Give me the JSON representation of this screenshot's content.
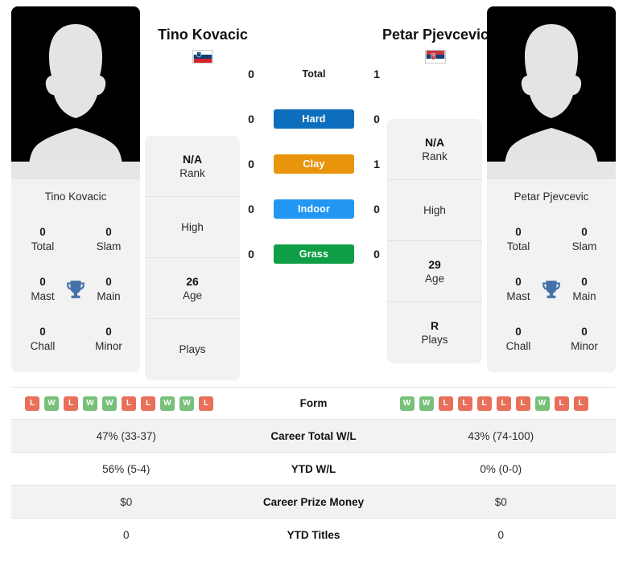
{
  "players": {
    "left": {
      "name": "Tino Kovacic",
      "card_name": "Tino Kovacic",
      "flag": "slovenia-flag",
      "rank": "N/A",
      "rank_label": "Rank",
      "high": "",
      "high_label": "High",
      "age": "26",
      "age_label": "Age",
      "plays": "",
      "plays_label": "Plays",
      "titles": {
        "total": "0",
        "total_label": "Total",
        "slam": "0",
        "slam_label": "Slam",
        "mast": "0",
        "mast_label": "Mast",
        "main": "0",
        "main_label": "Main",
        "chall": "0",
        "chall_label": "Chall",
        "minor": "0",
        "minor_label": "Minor"
      },
      "form": [
        "L",
        "W",
        "L",
        "W",
        "W",
        "L",
        "L",
        "W",
        "W",
        "L"
      ],
      "career_wl": "47% (33-37)",
      "ytd_wl": "56% (5-4)",
      "career_prize": "$0",
      "ytd_titles": "0"
    },
    "right": {
      "name": "Petar Pjevcevic",
      "card_name": "Petar Pjevcevic",
      "flag": "serbia-flag",
      "rank": "N/A",
      "rank_label": "Rank",
      "high": "",
      "high_label": "High",
      "age": "29",
      "age_label": "Age",
      "plays": "R",
      "plays_label": "Plays",
      "titles": {
        "total": "0",
        "total_label": "Total",
        "slam": "0",
        "slam_label": "Slam",
        "mast": "0",
        "mast_label": "Mast",
        "main": "0",
        "main_label": "Main",
        "chall": "0",
        "chall_label": "Chall",
        "minor": "0",
        "minor_label": "Minor"
      },
      "form": [
        "W",
        "W",
        "L",
        "L",
        "L",
        "L",
        "L",
        "W",
        "L",
        "L"
      ],
      "career_wl": "43% (74-100)",
      "ytd_wl": "0% (0-0)",
      "career_prize": "$0",
      "ytd_titles": "0"
    }
  },
  "head_to_head": {
    "total": {
      "label": "Total",
      "left": "0",
      "right": "1"
    },
    "surfaces": [
      {
        "label": "Hard",
        "left": "0",
        "right": "0",
        "color": "#0d6ebd"
      },
      {
        "label": "Clay",
        "left": "0",
        "right": "1",
        "color": "#e8940c"
      },
      {
        "label": "Indoor",
        "left": "0",
        "right": "0",
        "color": "#2196f3"
      },
      {
        "label": "Grass",
        "left": "0",
        "right": "0",
        "color": "#0f9d45"
      }
    ]
  },
  "stats_table": {
    "rows": [
      {
        "label": "Form"
      },
      {
        "label": "Career Total W/L"
      },
      {
        "label": "YTD W/L"
      },
      {
        "label": "Career Prize Money"
      },
      {
        "label": "YTD Titles"
      }
    ]
  },
  "colors": {
    "win_badge": "#78c07a",
    "loss_badge": "#e8705a",
    "panel_bg": "#f2f2f2",
    "trophy": "#4472a8"
  }
}
